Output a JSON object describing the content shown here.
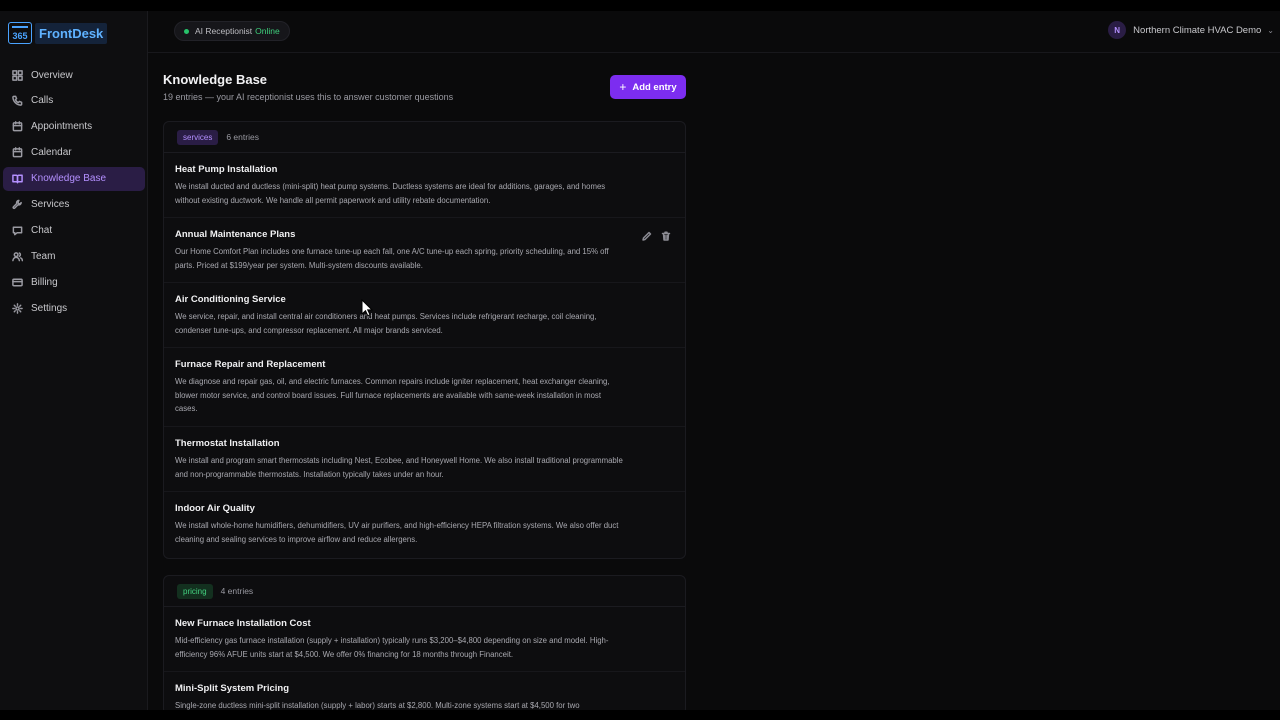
{
  "app": {
    "logo_badge": "365",
    "logo_text": "FrontDesk"
  },
  "sidebar": {
    "items": [
      {
        "label": "Overview",
        "icon": "grid-icon"
      },
      {
        "label": "Calls",
        "icon": "phone-icon"
      },
      {
        "label": "Appointments",
        "icon": "calendar-icon"
      },
      {
        "label": "Calendar",
        "icon": "calendar-icon"
      },
      {
        "label": "Knowledge Base",
        "icon": "book-icon",
        "active": true
      },
      {
        "label": "Services",
        "icon": "wrench-icon"
      },
      {
        "label": "Chat",
        "icon": "chat-icon"
      },
      {
        "label": "Team",
        "icon": "users-icon"
      },
      {
        "label": "Billing",
        "icon": "card-icon"
      },
      {
        "label": "Settings",
        "icon": "gear-icon"
      }
    ]
  },
  "header": {
    "status_label": "AI Receptionist",
    "status_value": "Online",
    "account_initial": "N",
    "account_name": "Northern Climate HVAC Demo"
  },
  "page": {
    "title": "Knowledge Base",
    "subtitle": "19 entries — your AI receptionist uses this to answer customer questions",
    "add_label": "Add entry"
  },
  "groups": [
    {
      "tag": "services",
      "count": "6 entries",
      "entries": [
        {
          "title": "Heat Pump Installation",
          "body": "We install ducted and ductless (mini-split) heat pump systems. Ductless systems are ideal for additions, garages, and homes without existing ductwork. We handle all permit paperwork and utility rebate documentation."
        },
        {
          "title": "Annual Maintenance Plans",
          "body": "Our Home Comfort Plan includes one furnace tune-up each fall, one A/C tune-up each spring, priority scheduling, and 15% off parts. Priced at $199/year per system. Multi-system discounts available."
        },
        {
          "title": "Air Conditioning Service",
          "body": "We service, repair, and install central air conditioners and heat pumps. Services include refrigerant recharge, coil cleaning, condenser tune-ups, and compressor replacement. All major brands serviced."
        },
        {
          "title": "Furnace Repair and Replacement",
          "body": "We diagnose and repair gas, oil, and electric furnaces. Common repairs include igniter replacement, heat exchanger cleaning, blower motor service, and control board issues. Full furnace replacements are available with same-week installation in most cases."
        },
        {
          "title": "Thermostat Installation",
          "body": "We install and program smart thermostats including Nest, Ecobee, and Honeywell Home. We also install traditional programmable and non-programmable thermostats. Installation typically takes under an hour."
        },
        {
          "title": "Indoor Air Quality",
          "body": "We install whole-home humidifiers, dehumidifiers, UV air purifiers, and high-efficiency HEPA filtration systems. We also offer duct cleaning and sealing services to improve airflow and reduce allergens."
        }
      ]
    },
    {
      "tag": "pricing",
      "count": "4 entries",
      "entries": [
        {
          "title": "New Furnace Installation Cost",
          "body": "Mid-efficiency gas furnace installation (supply + installation) typically runs $3,200–$4,800 depending on size and model. High-efficiency 96% AFUE units start at $4,500. We offer 0% financing for 18 months through Financeit."
        },
        {
          "title": "Mini-Split System Pricing",
          "body": "Single-zone ductless mini-split installation (supply + labor) starts at $2,800. Multi-zone systems start at $4,500 for two"
        }
      ]
    }
  ]
}
